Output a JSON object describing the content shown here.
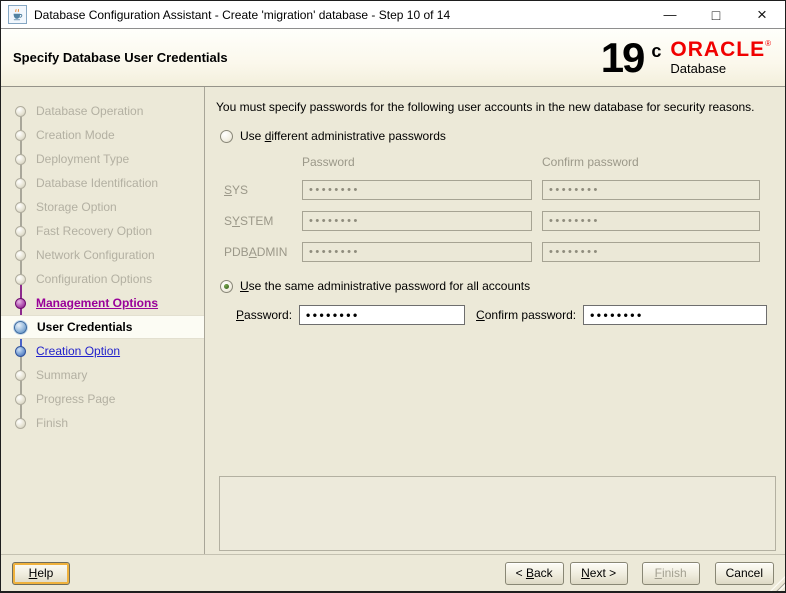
{
  "window": {
    "title": "Database Configuration Assistant - Create 'migration' database - Step 10 of 14",
    "controls": {
      "minimize": "—",
      "maximize": "□",
      "close": "×"
    }
  },
  "header": {
    "title": "Specify Database User Credentials",
    "logo": {
      "version": "19",
      "superscript": "c",
      "brand": "ORACLE",
      "registered": "®",
      "product": "Database",
      "brand_color": "#f00000"
    }
  },
  "sidebar": {
    "steps": [
      {
        "label": "Database Operation",
        "state": "future"
      },
      {
        "label": "Creation Mode",
        "state": "future"
      },
      {
        "label": "Deployment Type",
        "state": "future"
      },
      {
        "label": "Database Identification",
        "state": "future"
      },
      {
        "label": "Storage Option",
        "state": "future"
      },
      {
        "label": "Fast Recovery Option",
        "state": "future"
      },
      {
        "label": "Network Configuration",
        "state": "future"
      },
      {
        "label": "Configuration Options",
        "state": "future"
      },
      {
        "label": "Management Options",
        "state": "visited-link"
      },
      {
        "label": "User Credentials",
        "state": "current"
      },
      {
        "label": "Creation Option",
        "state": "next-link"
      },
      {
        "label": "Summary",
        "state": "future"
      },
      {
        "label": "Progress Page",
        "state": "future"
      },
      {
        "label": "Finish",
        "state": "future"
      }
    ],
    "visited_color": "#990099",
    "link_color": "#2222cc"
  },
  "main": {
    "intro": "You must specify passwords for the following user accounts in the new database for security reasons.",
    "option_different": {
      "pre": "Use ",
      "key": "d",
      "post": "ifferent administrative passwords",
      "selected": false
    },
    "columns": {
      "password": "Password",
      "confirm": "Confirm password"
    },
    "accounts": [
      {
        "pre": "",
        "key": "S",
        "post": "YS",
        "password": "••••••••",
        "confirm": "••••••••"
      },
      {
        "pre": "S",
        "key": "Y",
        "post": "STEM",
        "password": "••••••••",
        "confirm": "••••••••"
      },
      {
        "pre": "PDB",
        "key": "A",
        "post": "DMIN",
        "password": "••••••••",
        "confirm": "••••••••"
      }
    ],
    "option_same": {
      "pre": "",
      "key": "U",
      "post": "se the same administrative password for all accounts",
      "selected": true
    },
    "same_password": {
      "label_key": "P",
      "label_post": "assword:",
      "value": "••••••••"
    },
    "same_confirm": {
      "label_key": "C",
      "label_post": "onfirm password:",
      "value": "••••••••"
    }
  },
  "footer": {
    "help": {
      "pre": "",
      "key": "H",
      "post": "elp"
    },
    "back": {
      "pre": "< ",
      "key": "B",
      "post": "ack"
    },
    "next": {
      "pre": "",
      "key": "N",
      "post": "ext >"
    },
    "finish": {
      "pre": "",
      "key": "F",
      "post": "inish",
      "enabled": false
    },
    "cancel": {
      "pre": "Cancel",
      "key": "",
      "post": ""
    }
  }
}
